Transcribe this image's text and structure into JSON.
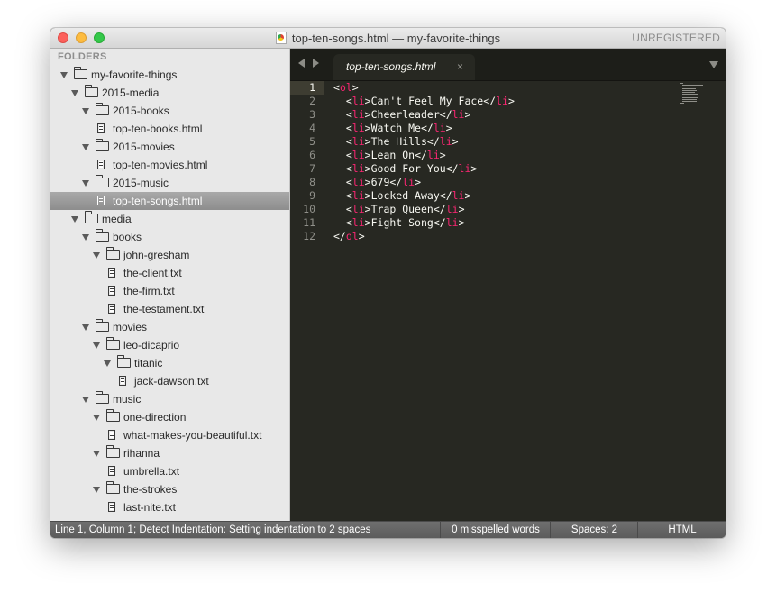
{
  "window": {
    "title": "top-ten-songs.html — my-favorite-things",
    "badge": "UNREGISTERED"
  },
  "sidebar": {
    "header": "FOLDERS",
    "tree": [
      {
        "label": "my-favorite-things",
        "type": "folder",
        "depth": 0
      },
      {
        "label": "2015-media",
        "type": "folder",
        "depth": 1
      },
      {
        "label": "2015-books",
        "type": "folder",
        "depth": 2
      },
      {
        "label": "top-ten-books.html",
        "type": "file",
        "depth": 3
      },
      {
        "label": "2015-movies",
        "type": "folder",
        "depth": 2
      },
      {
        "label": "top-ten-movies.html",
        "type": "file",
        "depth": 3
      },
      {
        "label": "2015-music",
        "type": "folder",
        "depth": 2
      },
      {
        "label": "top-ten-songs.html",
        "type": "file",
        "depth": 3,
        "selected": true
      },
      {
        "label": "media",
        "type": "folder",
        "depth": 1
      },
      {
        "label": "books",
        "type": "folder",
        "depth": 2
      },
      {
        "label": "john-gresham",
        "type": "folder",
        "depth": 3
      },
      {
        "label": "the-client.txt",
        "type": "file",
        "depth": 4
      },
      {
        "label": "the-firm.txt",
        "type": "file",
        "depth": 4
      },
      {
        "label": "the-testament.txt",
        "type": "file",
        "depth": 4
      },
      {
        "label": "movies",
        "type": "folder",
        "depth": 2
      },
      {
        "label": "leo-dicaprio",
        "type": "folder",
        "depth": 3
      },
      {
        "label": "titanic",
        "type": "folder",
        "depth": 4
      },
      {
        "label": "jack-dawson.txt",
        "type": "file",
        "depth": 5
      },
      {
        "label": "music",
        "type": "folder",
        "depth": 2
      },
      {
        "label": "one-direction",
        "type": "folder",
        "depth": 3
      },
      {
        "label": "what-makes-you-beautiful.txt",
        "type": "file",
        "depth": 4
      },
      {
        "label": "rihanna",
        "type": "folder",
        "depth": 3
      },
      {
        "label": "umbrella.txt",
        "type": "file",
        "depth": 4
      },
      {
        "label": "the-strokes",
        "type": "folder",
        "depth": 3
      },
      {
        "label": "last-nite.txt",
        "type": "file",
        "depth": 4
      }
    ]
  },
  "editor": {
    "tab": {
      "label": "top-ten-songs.html",
      "close": "×"
    },
    "current_line": 1,
    "lines": [
      {
        "n": "1",
        "indent": "",
        "tag": "ol",
        "text": "",
        "close": ""
      },
      {
        "n": "2",
        "indent": "  ",
        "tag": "li",
        "text": "Can't Feel My Face",
        "close": "li"
      },
      {
        "n": "3",
        "indent": "  ",
        "tag": "li",
        "text": "Cheerleader",
        "close": "li"
      },
      {
        "n": "4",
        "indent": "  ",
        "tag": "li",
        "text": "Watch Me",
        "close": "li"
      },
      {
        "n": "5",
        "indent": "  ",
        "tag": "li",
        "text": "The Hills",
        "close": "li"
      },
      {
        "n": "6",
        "indent": "  ",
        "tag": "li",
        "text": "Lean On",
        "close": "li"
      },
      {
        "n": "7",
        "indent": "  ",
        "tag": "li",
        "text": "Good For You",
        "close": "li"
      },
      {
        "n": "8",
        "indent": "  ",
        "tag": "li",
        "text": "679",
        "close": "li"
      },
      {
        "n": "9",
        "indent": "  ",
        "tag": "li",
        "text": "Locked Away",
        "close": "li"
      },
      {
        "n": "10",
        "indent": "  ",
        "tag": "li",
        "text": "Trap Queen",
        "close": "li"
      },
      {
        "n": "11",
        "indent": "  ",
        "tag": "li",
        "text": "Fight Song",
        "close": "li"
      },
      {
        "n": "12",
        "indent": "",
        "tag": "",
        "text": "",
        "close": "ol"
      }
    ]
  },
  "status": {
    "position": "Line 1, Column 1; Detect Indentation: Setting indentation to 2 spaces",
    "spelling": "0 misspelled words",
    "spaces": "Spaces: 2",
    "syntax": "HTML"
  },
  "colors": {
    "editor_bg": "#272822",
    "tag": "#f92672",
    "text": "#f8f8f2",
    "sidebar_bg": "#e8e8e8"
  }
}
